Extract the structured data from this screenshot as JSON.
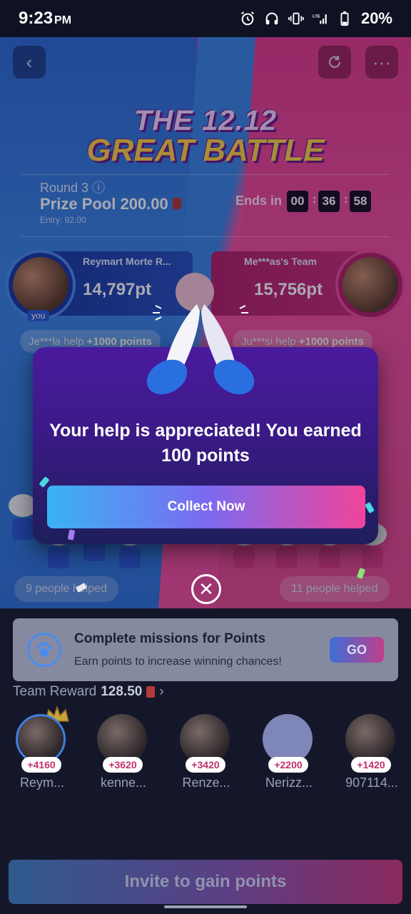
{
  "status_bar": {
    "time": "9:23",
    "ampm": "PM",
    "battery": "20%"
  },
  "game": {
    "title_line1": "THE 12.12",
    "title_line2": "GREAT BATTLE",
    "round_label": "Round 3",
    "prize_pool": "Prize Pool 200.00",
    "entry": "Entry: 92.00",
    "ends_in_label": "Ends in",
    "timer": [
      "00",
      "36",
      "58"
    ],
    "left_team": {
      "name": "Reymart Morte R...",
      "points": "14,797pt",
      "you_tag": "you",
      "help_prefix": "Je***la help",
      "help_bonus": "+1000 points",
      "people_helped": "9 people helped"
    },
    "right_team": {
      "name": "Me***as's Team",
      "points": "15,756pt",
      "help_prefix": "Ju***si help",
      "help_bonus": "+1000 points",
      "people_helped": "11 people helped"
    }
  },
  "modal": {
    "message": "Your help is appreciated! You earned 100 points",
    "collect_label": "Collect Now"
  },
  "mission": {
    "title": "Complete missions for Points",
    "subtitle": "Earn points to increase winning chances!",
    "go_label": "GO"
  },
  "team_reward": {
    "label": "Team Reward",
    "amount": "128.50",
    "members": [
      {
        "points": "+4160",
        "name": "Reym..."
      },
      {
        "points": "+3620",
        "name": "kenne..."
      },
      {
        "points": "+3420",
        "name": "Renze..."
      },
      {
        "points": "+2200",
        "name": "Nerizz..."
      },
      {
        "points": "+1420",
        "name": "907114..."
      }
    ]
  },
  "invite_label": "Invite to gain points",
  "colors": {
    "team_blue": "#2f74d9",
    "team_pink": "#e24a92",
    "modal_purple": "#4a1a9e",
    "accent_pink": "#f0449a"
  }
}
